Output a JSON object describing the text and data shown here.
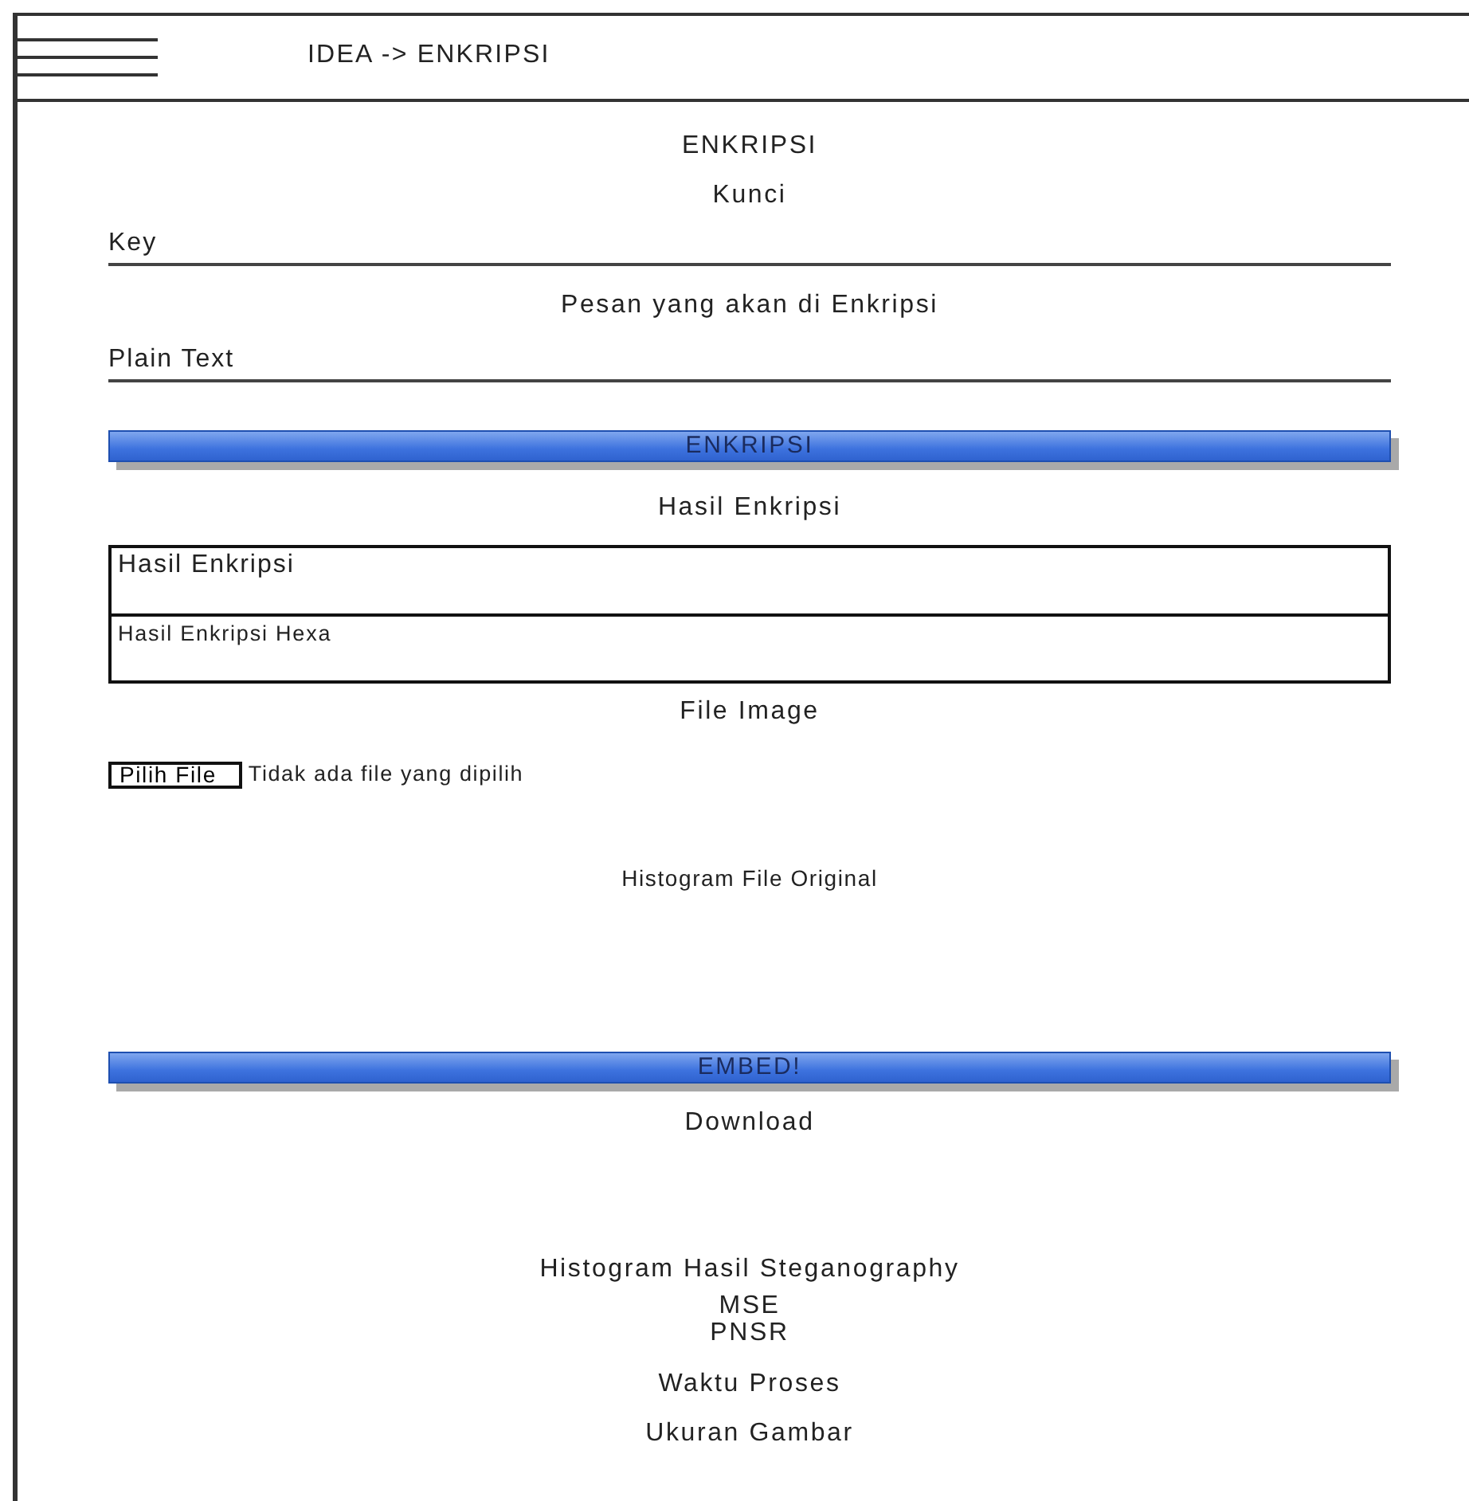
{
  "header": {
    "title": "IDEA -> ENKRIPSI"
  },
  "form": {
    "title": "ENKRIPSI",
    "key_label": "Kunci",
    "key_field": {
      "placeholder": "Key"
    },
    "message_label": "Pesan yang akan di Enkripsi",
    "message_field": {
      "placeholder": "Plain Text"
    },
    "encrypt_button": "ENKRIPSI",
    "result_label": "Hasil Enkripsi",
    "result_rows": [
      "Hasil Enkripsi",
      "Hasil Enkripsi Hexa"
    ],
    "file_label": "File Image",
    "file_button": "Pilih File",
    "file_status": "Tidak ada file yang dipilih",
    "histogram_original": "Histogram File Original",
    "embed_button": "EMBED!",
    "download": "Download",
    "histogram_result": "Histogram Hasil Steganography",
    "metrics": [
      "MSE",
      "PNSR"
    ],
    "process_time": "Waktu Proses",
    "image_size": "Ukuran Gambar"
  }
}
